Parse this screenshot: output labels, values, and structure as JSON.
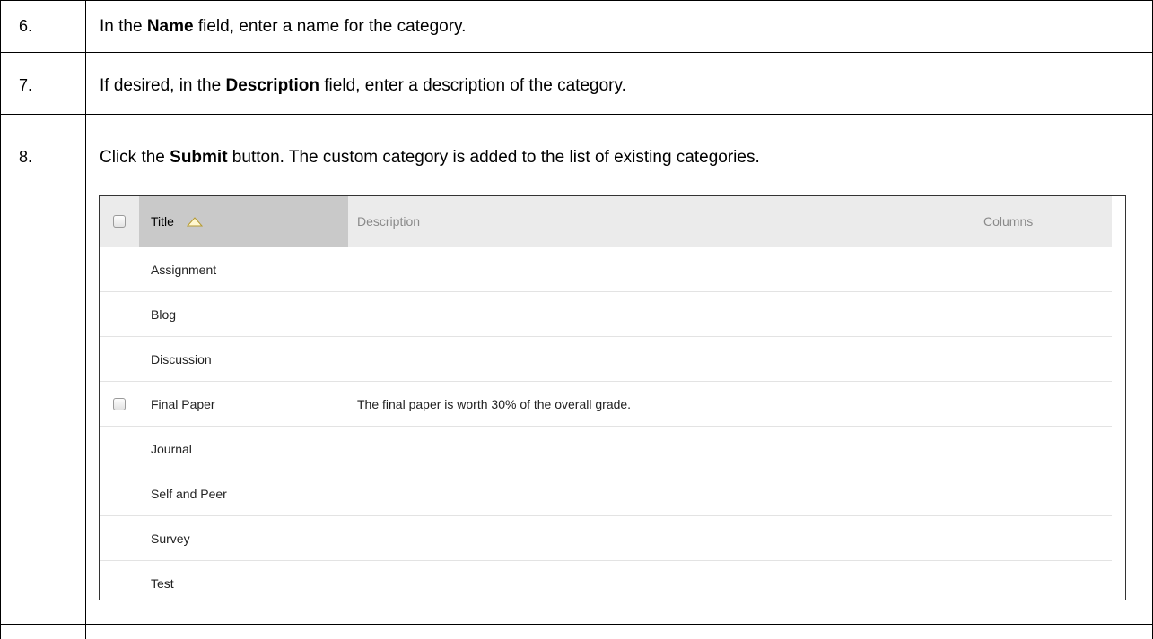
{
  "steps": [
    {
      "number": "6.",
      "parts": [
        "In the ",
        "Name",
        " field, enter a name for the category."
      ]
    },
    {
      "number": "7.",
      "parts": [
        "If desired, in the ",
        "Description",
        " field, enter a description of the category."
      ]
    },
    {
      "number": "8.",
      "parts": [
        "Click the ",
        "Submit",
        " button. The custom category is added to the list of existing categories."
      ]
    }
  ],
  "categories_table": {
    "columns": {
      "title": "Title",
      "description": "Description",
      "columns": "Columns"
    },
    "sort_icon": "sort-ascending-icon",
    "rows": [
      {
        "title": "Assignment",
        "description": "",
        "has_checkbox": false
      },
      {
        "title": "Blog",
        "description": "",
        "has_checkbox": false
      },
      {
        "title": "Discussion",
        "description": "",
        "has_checkbox": false
      },
      {
        "title": "Final Paper",
        "description": "The final paper is worth 30% of the overall grade.",
        "has_checkbox": true
      },
      {
        "title": "Journal",
        "description": "",
        "has_checkbox": false
      },
      {
        "title": "Self and Peer",
        "description": "",
        "has_checkbox": false
      },
      {
        "title": "Survey",
        "description": "",
        "has_checkbox": false
      },
      {
        "title": "Test",
        "description": "",
        "has_checkbox": false
      }
    ]
  }
}
